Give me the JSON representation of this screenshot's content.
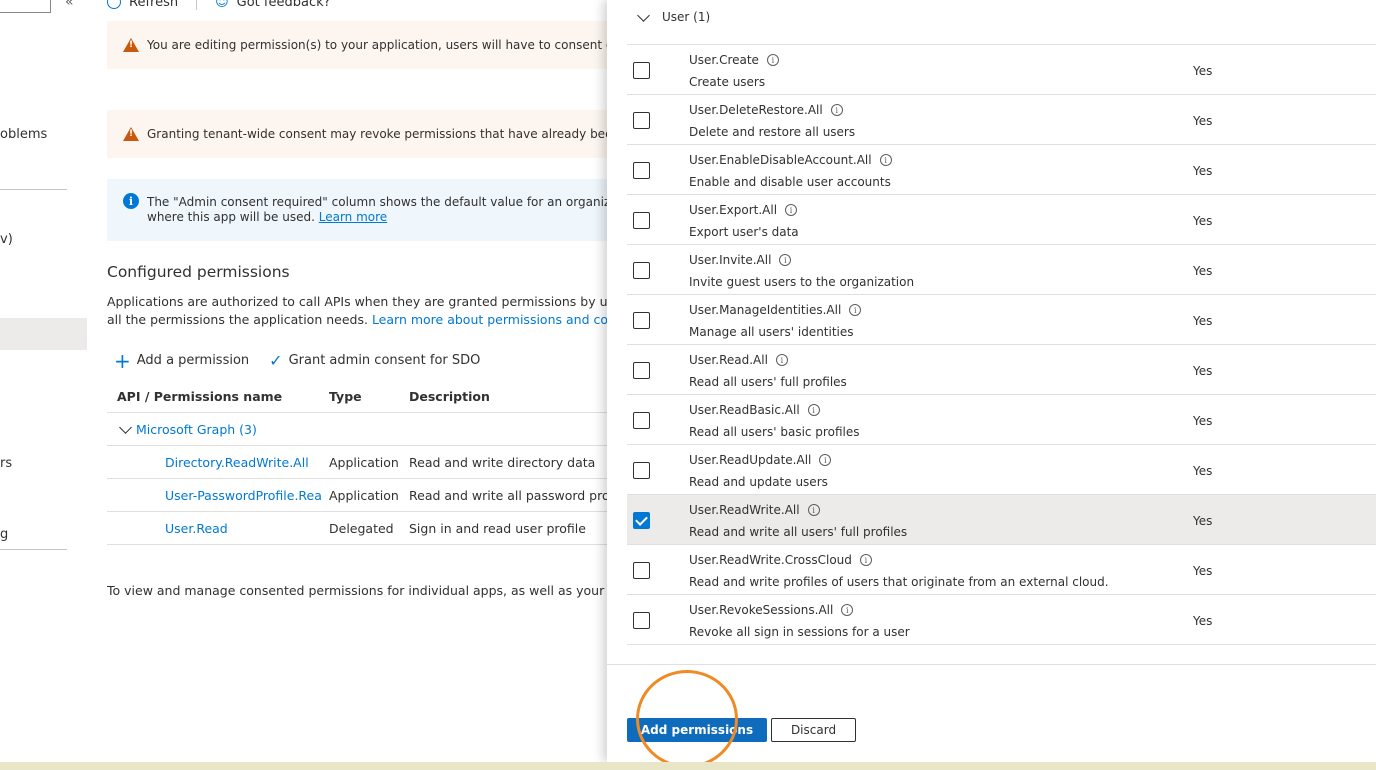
{
  "left_nav": {
    "items": [
      {
        "label": "oblems"
      },
      {
        "label": "v)"
      },
      {
        "label": "rs"
      },
      {
        "label": "g"
      }
    ]
  },
  "toolbar": {
    "refresh_label": "Refresh",
    "feedback_label": "Got feedback?"
  },
  "messages": {
    "editing_warning": "You are editing permission(s) to your application, users will have to consent even if they",
    "tenant_warning": "Granting tenant-wide consent may revoke permissions that have already been granted",
    "info_line1": "The \"Admin consent required\" column shows the default value for an organization. How",
    "info_line2": "where this app will be used.",
    "info_link": "Learn more"
  },
  "configured": {
    "title": "Configured permissions",
    "desc_line1": "Applications are authorized to call APIs when they are granted permissions by users/adr",
    "desc_line2": "all the permissions the application needs.",
    "desc_link": "Learn more about permissions and consent",
    "add_permission": "Add a permission",
    "grant_consent": "Grant admin consent for SDO",
    "columns": [
      "API / Permissions name",
      "Type",
      "Description"
    ],
    "group": "Microsoft Graph (3)",
    "rows": [
      {
        "name": "Directory.ReadWrite.All",
        "type": "Application",
        "description": "Read and write directory data"
      },
      {
        "name": "User-PasswordProfile.ReadWr",
        "type": "Application",
        "description": "Read and write all password profile"
      },
      {
        "name": "User.Read",
        "type": "Delegated",
        "description": "Sign in and read user profile"
      }
    ],
    "footnote": "To view and manage consented permissions for individual apps, as well as your tenant's"
  },
  "panel": {
    "group_label": "User (1)",
    "permissions": [
      {
        "name": "User.Create",
        "description": "Create users",
        "admin": "Yes",
        "checked": false
      },
      {
        "name": "User.DeleteRestore.All",
        "description": "Delete and restore all users",
        "admin": "Yes",
        "checked": false
      },
      {
        "name": "User.EnableDisableAccount.All",
        "description": "Enable and disable user accounts",
        "admin": "Yes",
        "checked": false
      },
      {
        "name": "User.Export.All",
        "description": "Export user's data",
        "admin": "Yes",
        "checked": false
      },
      {
        "name": "User.Invite.All",
        "description": "Invite guest users to the organization",
        "admin": "Yes",
        "checked": false
      },
      {
        "name": "User.ManageIdentities.All",
        "description": "Manage all users' identities",
        "admin": "Yes",
        "checked": false
      },
      {
        "name": "User.Read.All",
        "description": "Read all users' full profiles",
        "admin": "Yes",
        "checked": false
      },
      {
        "name": "User.ReadBasic.All",
        "description": "Read all users' basic profiles",
        "admin": "Yes",
        "checked": false
      },
      {
        "name": "User.ReadUpdate.All",
        "description": "Read and update users",
        "admin": "Yes",
        "checked": false
      },
      {
        "name": "User.ReadWrite.All",
        "description": "Read and write all users' full profiles",
        "admin": "Yes",
        "checked": true
      },
      {
        "name": "User.ReadWrite.CrossCloud",
        "description": "Read and write profiles of users that originate from an external cloud.",
        "admin": "Yes",
        "checked": false
      },
      {
        "name": "User.RevokeSessions.All",
        "description": "Revoke all sign in sessions for a user",
        "admin": "Yes",
        "checked": false
      }
    ],
    "add_button": "Add permissions",
    "discard_button": "Discard"
  },
  "colors": {
    "accent": "#0078d4",
    "primary_button": "#0f6cbd",
    "warning": "#c8590d",
    "highlight_ring": "#f08a24"
  }
}
